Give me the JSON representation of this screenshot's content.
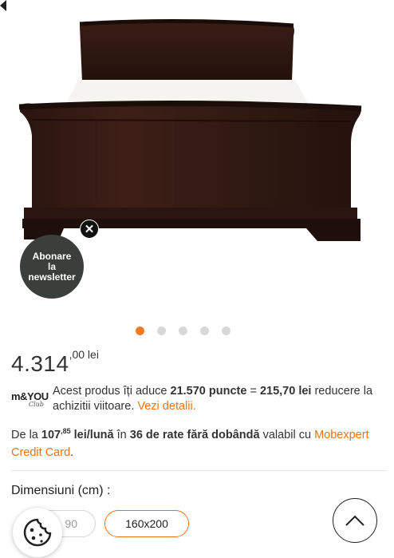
{
  "newsletter": {
    "line1": "Abonare",
    "line2": "la",
    "line3": "newsletter",
    "close_icon": "close-icon"
  },
  "carousel": {
    "total": 5,
    "active": 1
  },
  "price": {
    "integer": "4.314",
    "decimals": ",00 lei"
  },
  "points": {
    "logo_main": "m&YOU",
    "logo_script": "Club",
    "text_before": "Acest produs îți aduce ",
    "points_value": "21.570 puncte",
    "equals": " = ",
    "lei_value": "215,70 lei",
    "text_after": " reducere la achizitii viitoare. ",
    "details_link": "Vezi detalii."
  },
  "installments": {
    "prefix": "De la ",
    "amount": "107",
    "amount_decimals": ",85",
    "per_month": " lei/lună",
    "in_text": " în ",
    "rate_count": "36 de rate fără dobândă",
    "suffix": " valabil cu ",
    "link": "Mobexpert Credit Card",
    "end": "."
  },
  "dimensions": {
    "title": "Dimensiuni (cm) :",
    "options": [
      "90",
      "160x200"
    ],
    "selected": "160x200"
  },
  "colors": {
    "accent": "#e8751a",
    "badge": "#3b3f3b"
  }
}
